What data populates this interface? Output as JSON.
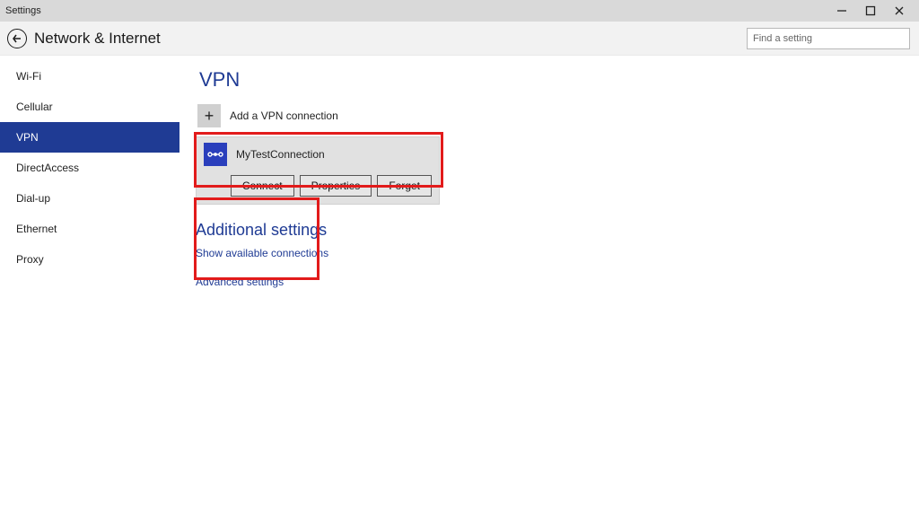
{
  "window": {
    "title": "Settings"
  },
  "header": {
    "breadcrumb": "Network & Internet",
    "search_placeholder": "Find a setting"
  },
  "sidebar": {
    "items": [
      {
        "label": "Wi-Fi"
      },
      {
        "label": "Cellular"
      },
      {
        "label": "VPN"
      },
      {
        "label": "DirectAccess"
      },
      {
        "label": "Dial-up"
      },
      {
        "label": "Ethernet"
      },
      {
        "label": "Proxy"
      }
    ],
    "selected_index": 2
  },
  "page": {
    "title": "VPN",
    "add_label": "Add a VPN connection",
    "connection": {
      "name": "MyTestConnection",
      "connect_label": "Connect",
      "properties_label": "Properties",
      "forget_label": "Forget"
    },
    "additional": {
      "title": "Additional settings",
      "show_link": "Show available connections",
      "advanced_link": "Advanced settings"
    }
  }
}
